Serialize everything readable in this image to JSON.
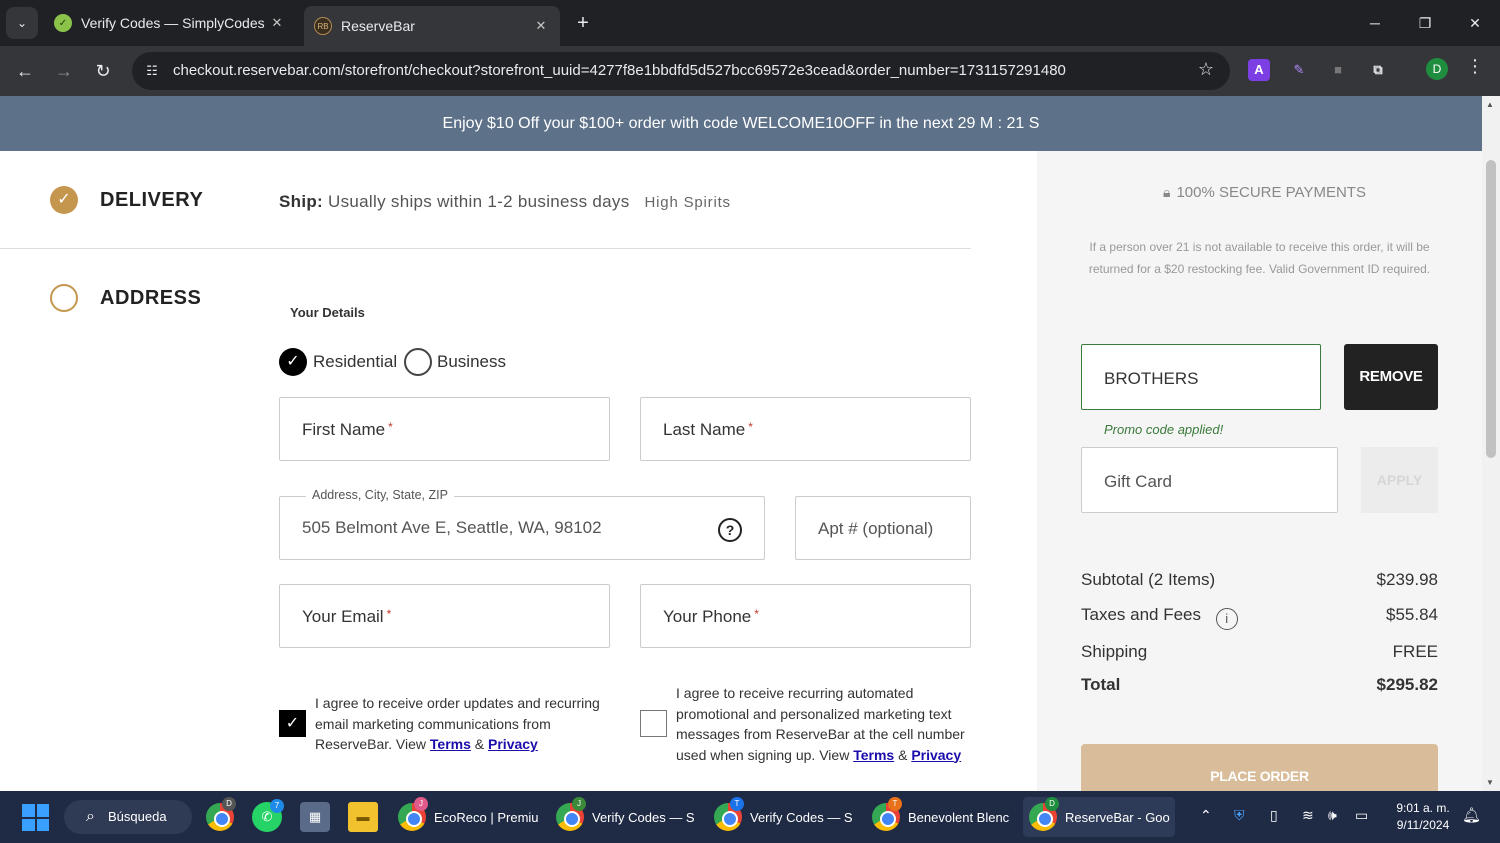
{
  "browser": {
    "tabs": [
      {
        "title": "Verify Codes — SimplyCodes",
        "icon": "simplycodes-icon"
      },
      {
        "title": "ReserveBar",
        "icon": "reservebar-icon",
        "favicon_text": "RB"
      }
    ],
    "url": "checkout.reservebar.com/storefront/checkout?storefront_uuid=4277f8e1bbdfd5d527bcc69572e3cead&order_number=1731157291480",
    "profile_initial": "D",
    "extension_a": "A"
  },
  "promo_banner": "Enjoy $10 Off your $100+ order with code WELCOME10OFF in the next  29 M : 21 S",
  "steps": {
    "delivery": {
      "title": "DELIVERY",
      "ship_label": "Ship:",
      "ship_text": "Usually ships within 1-2 business days",
      "seller": "High Spirits"
    },
    "address": {
      "title": "ADDRESS"
    }
  },
  "form": {
    "details_label": "Your Details",
    "type_options": [
      {
        "label": "Residential",
        "selected": true
      },
      {
        "label": "Business",
        "selected": false
      }
    ],
    "first_name": "First Name",
    "last_name": "Last Name",
    "required_mark": "*",
    "address_label": "Address, City, State, ZIP",
    "address_value": "505 Belmont Ave E, Seattle, WA, 98102",
    "apt_placeholder": "Apt # (optional)",
    "email": "Your Email",
    "phone": "Your Phone",
    "email_consent": {
      "checked": true,
      "text": "I agree to receive order updates and recurring email marketing communications from ReserveBar. View",
      "terms": "Terms",
      "amp": "&",
      "privacy": "Privacy"
    },
    "sms_consent": {
      "checked": false,
      "text": "I agree to receive recurring automated promotional and personalized marketing text messages from ReserveBar at the cell number used when signing up. View",
      "terms": "Terms",
      "amp": "&",
      "privacy": "Privacy"
    }
  },
  "sidebar": {
    "secure": "100% SECURE PAYMENTS",
    "age_note": "If a person over 21 is not available to receive this order, it will be returned for a $20 restocking fee. Valid Government ID required.",
    "promo_code": "BROTHERS",
    "remove_label": "REMOVE",
    "promo_applied": "Promo code applied!",
    "gift_placeholder": "Gift Card",
    "apply_label": "APPLY",
    "summary": {
      "subtotal_label": "Subtotal (2 Items)",
      "subtotal": "$239.98",
      "taxes_label": "Taxes and Fees",
      "taxes": "$55.84",
      "shipping_label": "Shipping",
      "shipping": "FREE",
      "total_label": "Total",
      "total": "$295.82"
    },
    "place_order": "PLACE ORDER"
  },
  "taskbar": {
    "search": "Búsqueda",
    "apps": [
      {
        "label": "EcoReco | Premiu",
        "badge": "J"
      },
      {
        "label": "Verify Codes — S",
        "badge": "J"
      },
      {
        "label": "Verify Codes — S",
        "badge": "T"
      },
      {
        "label": "Benevolent Blenc",
        "badge": "T"
      },
      {
        "label": "ReserveBar - Goo",
        "badge": "D"
      }
    ],
    "whatsapp_badge": "7",
    "chrome_badge": "D",
    "time": "9:01 a. m.",
    "date": "9/11/2024"
  },
  "colors": {
    "banner": "#5d7188",
    "accent_gold": "#c5974e",
    "promo_green": "#3a7a3a",
    "place_order": "#d9bc9a"
  }
}
